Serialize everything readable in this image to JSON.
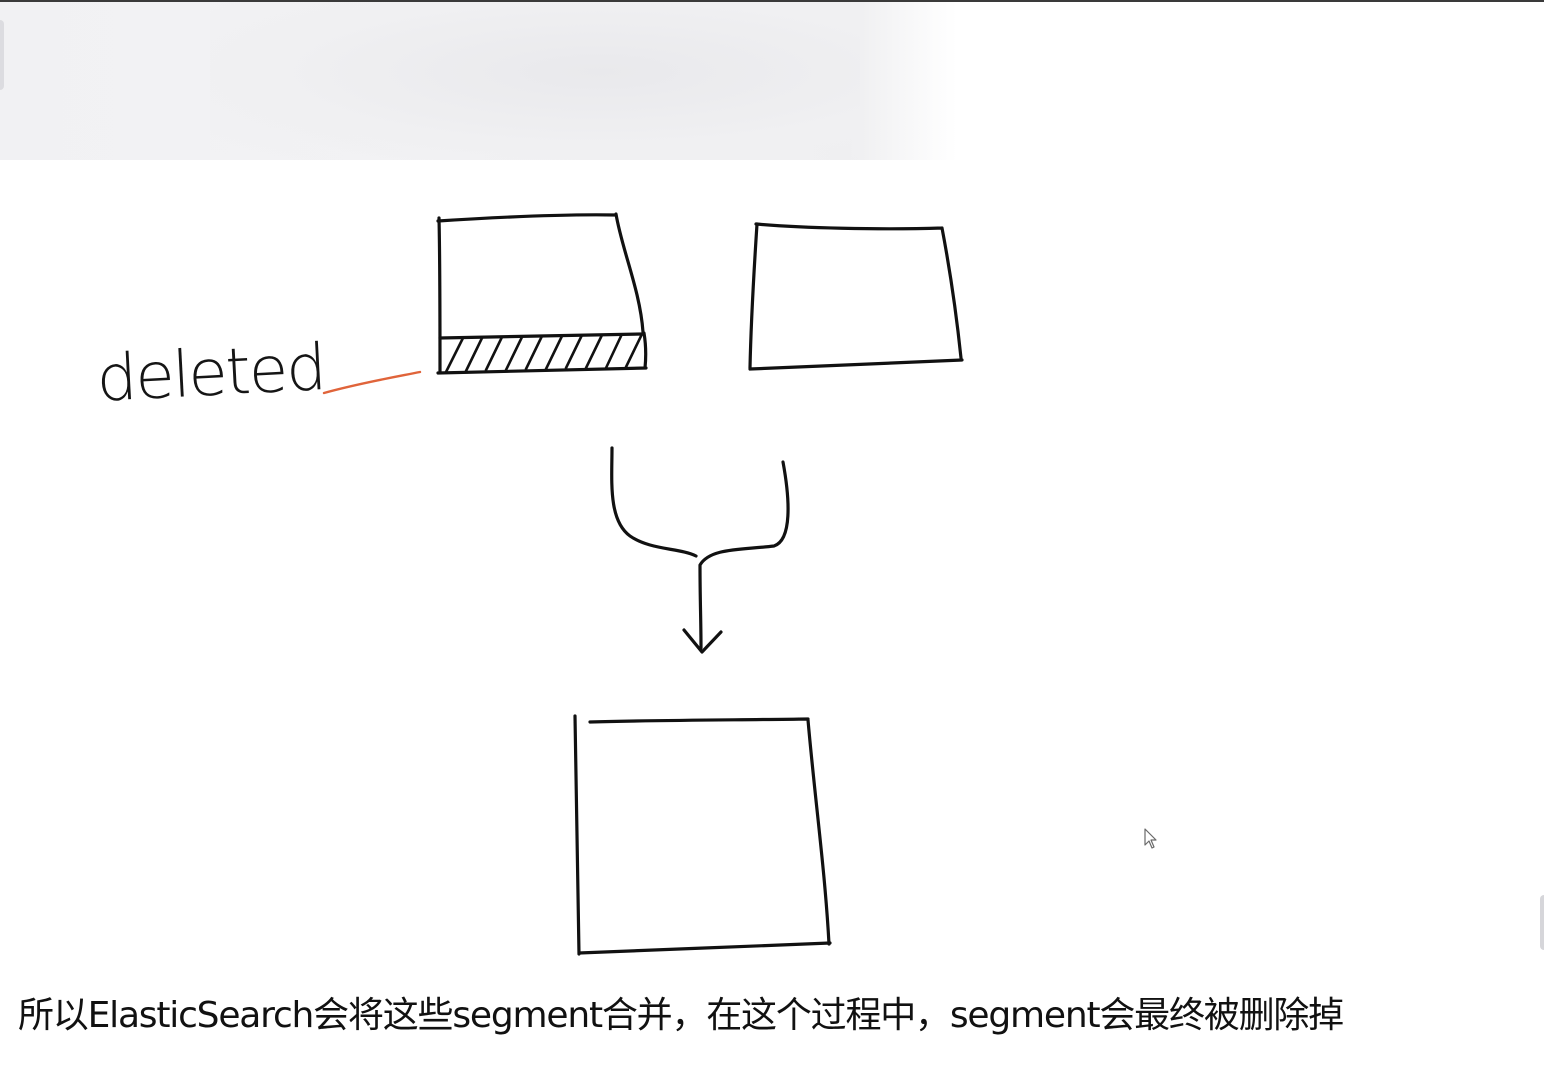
{
  "diagram": {
    "deleted_label": "deleted",
    "leader_color": "#e0643a",
    "ink_color": "#111111"
  },
  "caption": {
    "text": "所以ElasticSearch会将这些segment合并，在这个过程中，segment会最终被删除掉"
  },
  "icons": {
    "cursor": "mouse-pointer-icon"
  }
}
